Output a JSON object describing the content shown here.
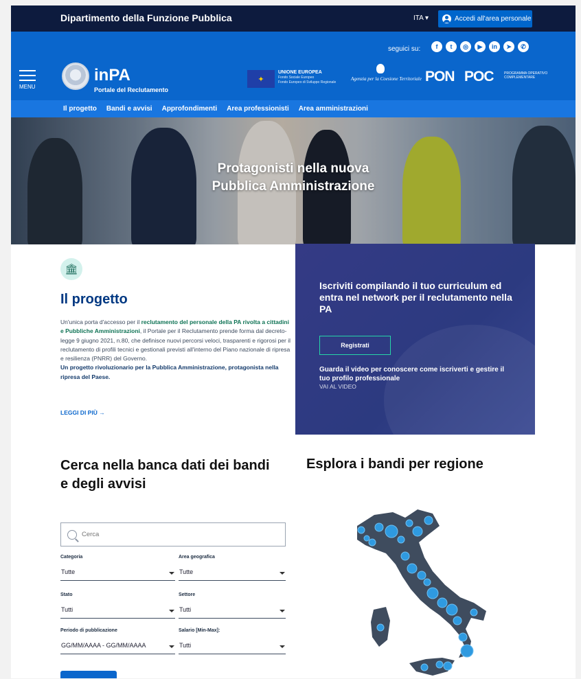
{
  "topbar": {
    "department": "Dipartimento della Funzione Pubblica",
    "language": "ITA",
    "login_label": "Accedi all'area personale"
  },
  "header": {
    "social_label": "seguici su:",
    "social_icons": [
      "facebook-icon",
      "twitter-icon",
      "instagram-icon",
      "youtube-icon",
      "linkedin-icon",
      "telegram-icon",
      "whatsapp-icon"
    ],
    "menu_label": "MENU",
    "brand_title": "inPA",
    "brand_subtitle": "Portale del Reclutamento",
    "eu_title": "UNIONE EUROPEA",
    "eu_line1": "Fondo Sociale Europeo",
    "eu_line2": "Fondo Europeo di Sviluppo Regionale",
    "agency": "Agenzia per la Coesione Territoriale",
    "pon": "PON",
    "poc": "POC",
    "poc_sub": "PROGRAMMA OPERATIVO COMPLEMENTARE"
  },
  "nav": {
    "items": [
      "Il progetto",
      "Bandi e avvisi",
      "Approfondimenti",
      "Area professionisti",
      "Area amministrazioni"
    ]
  },
  "hero": {
    "title_line1": "Protagonisti nella nuova",
    "title_line2": "Pubblica Amministrazione"
  },
  "project": {
    "title": "Il progetto",
    "text_p1": "Un'unica porta d'accesso per il ",
    "text_b1": "reclutamento del personale della PA rivolta a cittadini e Pubbliche Amministrazioni",
    "text_p2": ", il Portale per il Reclutamento prende forma dal decreto-legge 9 giugno 2021, n.80, che definisce nuovi percorsi veloci, trasparenti e rigorosi per il reclutamento di profili tecnici e gestionali previsti all'interno del Piano nazionale di ripresa e resilienza (PNRR) del Governo.",
    "text_b2": "Un progetto rivoluzionario per la Pubblica Amministrazione, protagonista nella ripresa del Paese.",
    "link": "LEGGI DI PIÙ →"
  },
  "promo": {
    "title": "Iscriviti compilando il tuo curriculum ed entra nel network per il reclutamento nella PA",
    "button": "Registrati",
    "subtitle": "Guarda il video per conoscere come iscriverti e gestire il tuo profilo professionale",
    "link": "VAI AL VIDEO"
  },
  "search": {
    "title": "Cerca nella banca dati dei bandi e degli avvisi",
    "placeholder": "Cerca",
    "fields": {
      "categoria": {
        "label": "Categoria",
        "value": "Tutte"
      },
      "area": {
        "label": "Area geografica",
        "value": "Tutte"
      },
      "stato": {
        "label": "Stato",
        "value": "Tutti"
      },
      "settore": {
        "label": "Settore",
        "value": "Tutti"
      },
      "periodo": {
        "label": "Periodo di pubblicazione",
        "value": "GG/MM/AAAA - GG/MM/AAAA"
      },
      "salario": {
        "label": "Salario [Min-Max]:",
        "value": "Tutti"
      }
    }
  },
  "map": {
    "title": "Esplora i bandi per regione",
    "colors": {
      "land": "#3f4c5e",
      "dot": "#2f9ae0"
    }
  }
}
